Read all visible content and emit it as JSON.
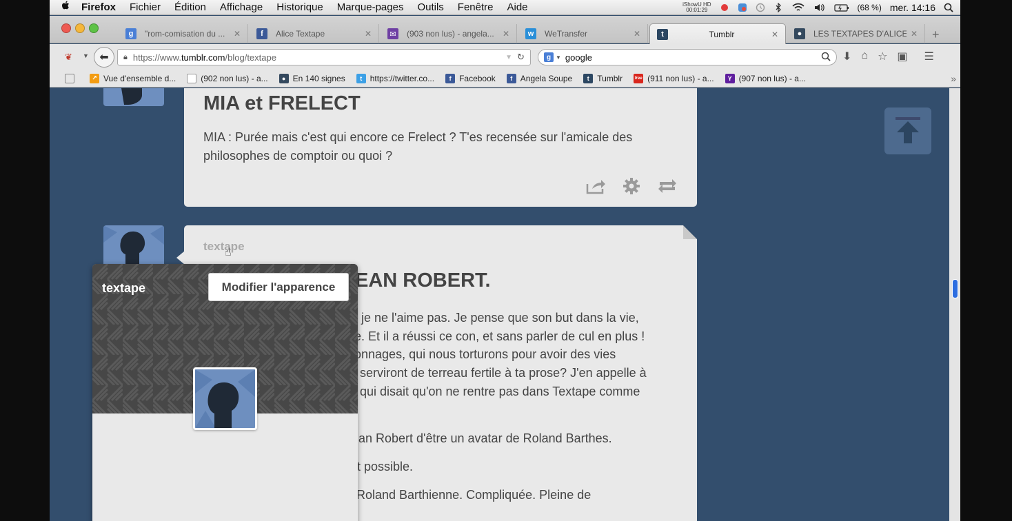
{
  "menubar": {
    "items": [
      "Firefox",
      "Fichier",
      "Édition",
      "Affichage",
      "Historique",
      "Marque-pages",
      "Outils",
      "Fenêtre",
      "Aide"
    ],
    "ishow_line1": "iShowU HD",
    "ishow_line2": "00:01:29",
    "battery": "(68 %)",
    "clock": "mer. 14:16"
  },
  "tabs": [
    {
      "title": "\"rom-comisation du ...",
      "icon": "google-icon",
      "color": "#4a7fd6",
      "glyph": "g"
    },
    {
      "title": "Alice Textape",
      "icon": "facebook-icon",
      "color": "#3b5998",
      "glyph": "f"
    },
    {
      "title": "(903 non lus) - angela...",
      "icon": "mail-icon",
      "color": "#6e3fa3",
      "glyph": "✉"
    },
    {
      "title": "WeTransfer",
      "icon": "wetransfer-icon",
      "color": "#2a8fd8",
      "glyph": "w"
    },
    {
      "title": "Tumblr",
      "icon": "tumblr-icon",
      "color": "#2c4762",
      "glyph": "t"
    },
    {
      "title": "LES TEXTAPES D'ALICE...",
      "icon": "blogger-icon",
      "color": "#34495e",
      "glyph": "●"
    }
  ],
  "navbar": {
    "url_prefix": "https://www.",
    "url_domain": "tumblr.com",
    "url_path": "/blog/textape",
    "search_value": "google"
  },
  "bookmarks": [
    {
      "label": "Vue d'ensemble d...",
      "icon": "chart-icon",
      "color": "#f39c12",
      "glyph": "↗"
    },
    {
      "label": "(902 non lus) - a...",
      "icon": "page-icon",
      "color": "#ffffff",
      "glyph": ""
    },
    {
      "label": "En 140 signes",
      "icon": "blog-icon",
      "color": "#34495e",
      "glyph": "●"
    },
    {
      "label": "https://twitter.co...",
      "icon": "twitter-icon",
      "color": "#3ca0e6",
      "glyph": "t"
    },
    {
      "label": "Facebook",
      "icon": "facebook-icon",
      "color": "#3b5998",
      "glyph": "f"
    },
    {
      "label": "Angela Soupe",
      "icon": "facebook-icon",
      "color": "#3b5998",
      "glyph": "f"
    },
    {
      "label": "Tumblr",
      "icon": "tumblr-icon",
      "color": "#2c4762",
      "glyph": "t"
    },
    {
      "label": "(911 non lus) - a...",
      "icon": "free-icon",
      "color": "#d9271e",
      "glyph": "free"
    },
    {
      "label": "(907 non lus) - a...",
      "icon": "yahoo-icon",
      "color": "#5f1f9e",
      "glyph": "Y"
    }
  ],
  "post1": {
    "title": "MIA et FRELECT",
    "body": "MIA : Purée mais c'est qui encore ce Frelect ? T'es recensée sur l'amicale des philosophes de comptoir ou quoi ?"
  },
  "post2": {
    "blogname": "textape",
    "title_visible": "EAN ROBERT.",
    "lines": [
      "t je ne l'aime pas. Je pense que son but dans la vie,",
      "e. Et il a réussi ce con, et sans parler de cul en plus !",
      "onnages, qui nous torturons pour avoir des vies",
      "serviront de terreau fertile à ta prose? J'en appelle à",
      "qui disait qu'on ne rentre pas dans Textape comme",
      "an Robert d'être un avatar de Roland Barthes.",
      "t possible.",
      "Roland Barthienne. Compliquée. Pleine de"
    ]
  },
  "popover": {
    "title": "textape",
    "customize_label": "Modifier l'apparence"
  },
  "colors": {
    "dashboard_bg": "#334e6d",
    "post_bg": "#e9e9e9",
    "avatar_blue": "#6e8fbf"
  }
}
